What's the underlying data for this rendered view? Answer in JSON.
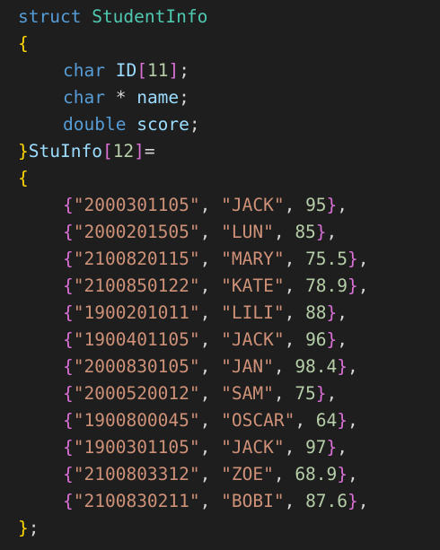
{
  "code": {
    "struct_keyword": "struct",
    "struct_name": "StudentInfo",
    "open_brace": "{",
    "fields": [
      {
        "type": "char",
        "ptr": "",
        "name": "ID",
        "array_open": "[",
        "size": "11",
        "array_close": "]",
        "semi": ";"
      },
      {
        "type": "char",
        "ptr": " * ",
        "name": "name",
        "semi": ";"
      },
      {
        "type": "double",
        "ptr": " ",
        "name": "score",
        "semi": ";"
      }
    ],
    "close_brace": "}",
    "var_name": "StuInfo",
    "var_array_open": "[",
    "var_size": "12",
    "var_array_close": "]",
    "assign": "=",
    "init_open": "{",
    "records": [
      {
        "id": "\"2000301105\"",
        "name": "\"JACK\"",
        "score": "95"
      },
      {
        "id": "\"2000201505\"",
        "name": "\"LUN\"",
        "score": "85"
      },
      {
        "id": "\"2100820115\"",
        "name": "\"MARY\"",
        "score": "75.5"
      },
      {
        "id": "\"2100850122\"",
        "name": "\"KATE\"",
        "score": "78.9"
      },
      {
        "id": "\"1900201011\"",
        "name": "\"LILI\"",
        "score": "88"
      },
      {
        "id": "\"1900401105\"",
        "name": "\"JACK\"",
        "score": "96"
      },
      {
        "id": "\"2000830105\"",
        "name": "\"JAN\"",
        "score": "98.4"
      },
      {
        "id": "\"2000520012\"",
        "name": "\"SAM\"",
        "score": "75"
      },
      {
        "id": "\"1900800045\"",
        "name": "\"OSCAR\"",
        "score": "64"
      },
      {
        "id": "\"1900301105\"",
        "name": "\"JACK\"",
        "score": "97"
      },
      {
        "id": "\"2100803312\"",
        "name": "\"ZOE\"",
        "score": "68.9"
      },
      {
        "id": "\"2100830211\"",
        "name": "\"BOBI\"",
        "score": "87.6"
      }
    ],
    "init_close": "}",
    "final_semi": ";"
  }
}
